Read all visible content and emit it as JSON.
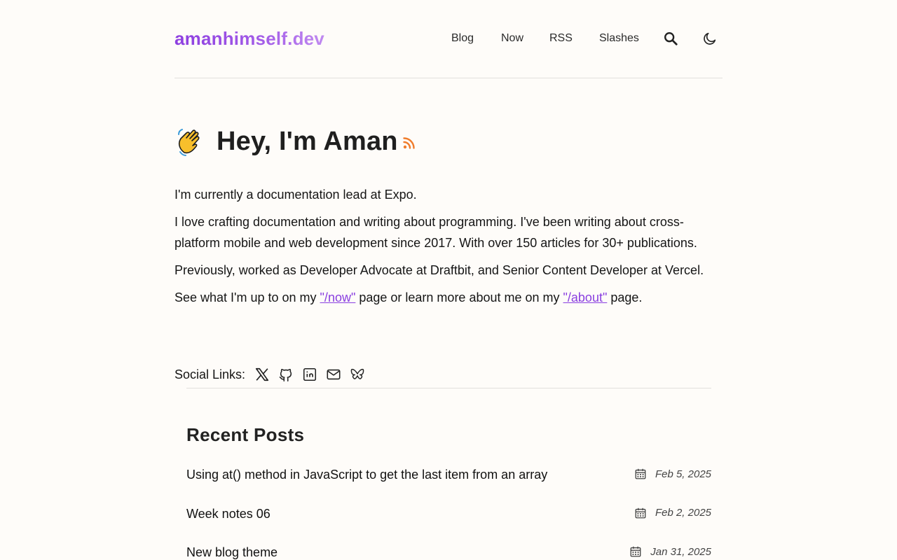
{
  "site": {
    "logo": "amanhimself.dev"
  },
  "nav": {
    "items": [
      "Blog",
      "Now",
      "RSS",
      "Slashes"
    ]
  },
  "hero": {
    "emoji": "👋",
    "title": "Hey, I'm Aman"
  },
  "intro": {
    "p1": "I'm currently a documentation lead at Expo.",
    "p2": "I love crafting documentation and writing about programming. I've been writing about cross-platform mobile and web development since 2017. With over 150 articles for 30+ publications.",
    "p3": "Previously, worked as Developer Advocate at Draftbit, and Senior Content Developer at Vercel.",
    "p4_before": "See what I'm up to on my ",
    "p4_link1": "\"/now\"",
    "p4_middle": " page or learn more about me on my ",
    "p4_link2": "\"/about\"",
    "p4_after": " page."
  },
  "social": {
    "label": "Social Links:",
    "icons": [
      "x-icon",
      "github-icon",
      "linkedin-icon",
      "mail-icon",
      "bluesky-icon"
    ]
  },
  "recent": {
    "title": "Recent Posts",
    "posts": [
      {
        "title": "Using at() method in JavaScript to get the last item from an array",
        "date": "Feb 5, 2025"
      },
      {
        "title": "Week notes 06",
        "date": "Feb 2, 2025"
      },
      {
        "title": "New blog theme",
        "date": "Jan 31, 2025"
      }
    ]
  },
  "colors": {
    "accent": "#8a3fe0",
    "rss": "#f07c2b",
    "background": "#fefcf9"
  }
}
